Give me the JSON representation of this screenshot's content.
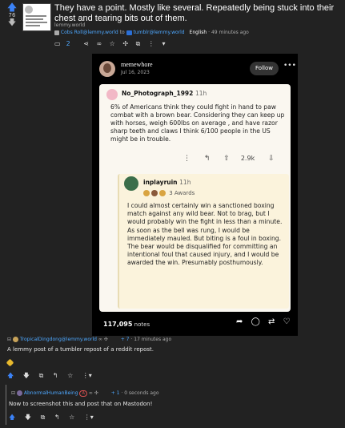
{
  "post": {
    "score": "76",
    "title": "They have a point. Mostly like several. Repeatedly being stuck into their chest and tearing bits out of them.",
    "domain": "lemmy.world",
    "author": "Cobs Roll@lemmy.world",
    "to": "to",
    "community": "tumblr@lemmy.world",
    "language": "English",
    "time": "· 49 minutes ago",
    "comment_count": "2"
  },
  "tumblr": {
    "blog_name": "memewhore",
    "date": "Jul 16, 2023",
    "follow_label": "Follow",
    "notes_count": "117,095",
    "notes_label": "notes",
    "reddit_comment": {
      "user": "No_Photograph_1992",
      "age": "11h",
      "body": "6% of Americans think they could fight in hand to paw combat with a brown bear. Considering they can keep up with horses, weigh 600lbs on average , and have razor sharp teeth and claws I think 6/100 people in the US might be in trouble.",
      "votes": "2.9k"
    },
    "reddit_reply": {
      "user": "inplayruin",
      "age": "11h",
      "awards": "3 Awards",
      "body": "I could almost certainly win a sanctioned boxing match against any wild bear. Not to brag, but I would probably win the fight in less than a minute. As soon as the bell was rung, I would be immediately mauled. But biting is a foul in boxing. The bear would be disqualified for committing an intentional foul that caused injury, and I would be awarded the win. Presumably posthumously."
    }
  },
  "comments": [
    {
      "user": "TropicalDingdong@lemmy.world",
      "score": "+ 7",
      "time": "· 17 minutes ago",
      "body": "A lemmy post of a tumbler repost of a reddit repost."
    },
    {
      "user": "AbnormalHumanBeing",
      "badge": "A",
      "score": "+ 1",
      "time": "· 0 seconds ago",
      "body": "Now to screenshot this and post that on Mastodon!"
    }
  ],
  "colors": {
    "background": "#222222",
    "link": "#4ea8ff",
    "upvote": "#3b82f6",
    "card": "#faf7f0",
    "reply_card": "#fbf3dc"
  }
}
